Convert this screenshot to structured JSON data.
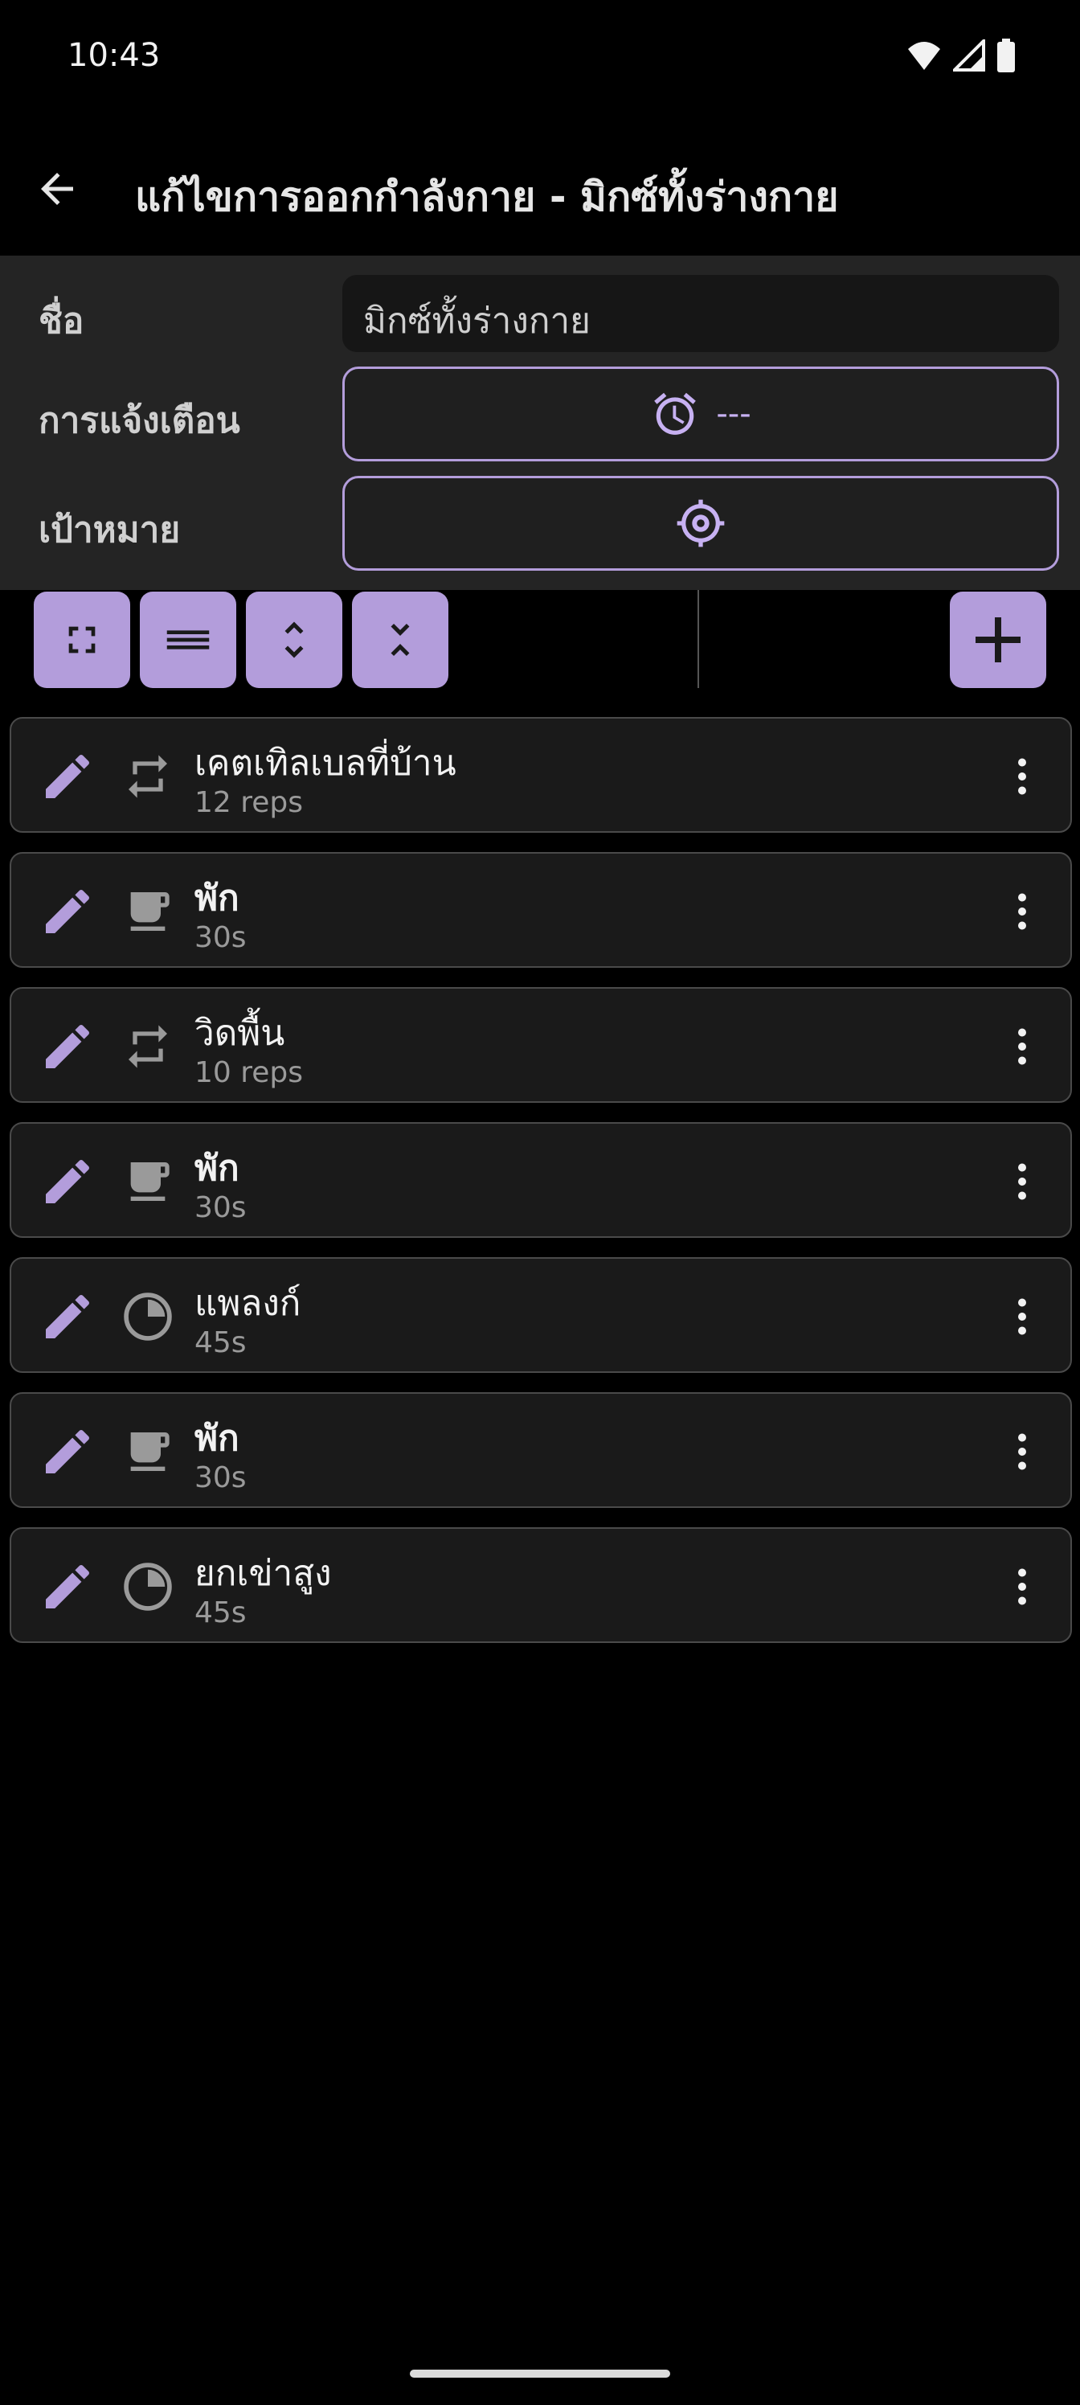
{
  "status": {
    "time": "10:43"
  },
  "header": {
    "title": "แก้ไขการออกกำลังกาย - มิกซ์ทั้งร่างกาย"
  },
  "form": {
    "name_label": "ชื่อ",
    "name_value": "มิกซ์ทั้งร่างกาย",
    "reminder_label": "การแจ้งเตือน",
    "reminder_value": "---",
    "goal_label": "เป้าหมาย"
  },
  "items": [
    {
      "title": "เคตเทิลเบลที่บ้าน",
      "subtitle": "12 reps",
      "type": "repeat-icon"
    },
    {
      "title": "พัก",
      "subtitle": "30s",
      "type": "coffee-cup-icon"
    },
    {
      "title": "วิดพื้น",
      "subtitle": "10 reps",
      "type": "repeat-icon"
    },
    {
      "title": "พัก",
      "subtitle": "30s",
      "type": "coffee-cup-icon"
    },
    {
      "title": "แพลงก์",
      "subtitle": "45s",
      "type": "timer-pie-icon"
    },
    {
      "title": "พัก",
      "subtitle": "30s",
      "type": "coffee-cup-icon"
    },
    {
      "title": "ยกเข่าสูง",
      "subtitle": "45s",
      "type": "timer-pie-icon"
    }
  ],
  "colors": {
    "accent": "#b39ddb",
    "background": "#000000",
    "panel": "#242424"
  }
}
